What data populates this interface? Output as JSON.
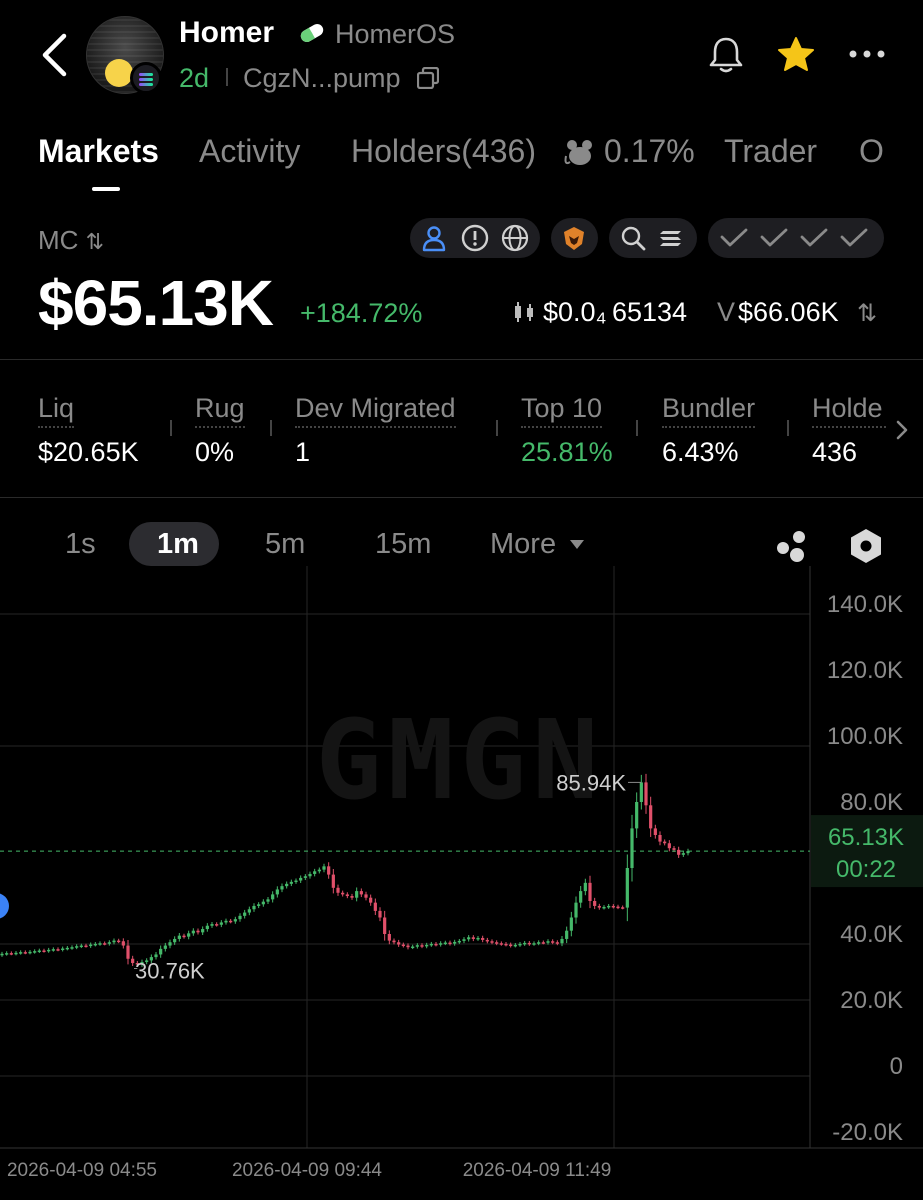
{
  "header": {
    "name": "Homer",
    "tag": "HomerOS",
    "age": "2d",
    "address": "CgzN...pump"
  },
  "tabs": [
    {
      "label": "Markets",
      "active": true
    },
    {
      "label": "Activity",
      "active": false
    },
    {
      "label": "Holders(436)",
      "active": false
    },
    {
      "label": "0.17%",
      "active": false
    },
    {
      "label": "Trader",
      "active": false
    },
    {
      "label": "O",
      "active": false
    }
  ],
  "market": {
    "mc_label": "MC",
    "mc_value": "$65.13K",
    "mc_change": "+184.72%",
    "price": "$0.0₄ 65134",
    "volume_label": "V",
    "volume": "$66.06K"
  },
  "stats": [
    {
      "label": "Liq",
      "value": "$20.65K",
      "color": "#ffffff"
    },
    {
      "label": "Rug",
      "value": "0%",
      "color": "#ffffff"
    },
    {
      "label": "Dev Migrated",
      "value": "1",
      "color": "#ffffff"
    },
    {
      "label": "Top 10",
      "value": "25.81%",
      "color": "#45b96a"
    },
    {
      "label": "Bundler",
      "value": "6.43%",
      "color": "#ffffff"
    },
    {
      "label": "Holde",
      "value": "436",
      "color": "#ffffff"
    }
  ],
  "timeframes": [
    {
      "label": "1s",
      "active": false
    },
    {
      "label": "1m",
      "active": true
    },
    {
      "label": "5m",
      "active": false
    },
    {
      "label": "15m",
      "active": false
    },
    {
      "label": "More",
      "active": false
    }
  ],
  "colors": {
    "up": "#45b96a",
    "down": "#e0506a",
    "muted": "#8a8a8a"
  },
  "chart_data": {
    "type": "candlestick",
    "watermark": "GMGN",
    "y_ticks": [
      "140.0K",
      "120.0K",
      "100.0K",
      "80.0K",
      "60.0K",
      "40.0K",
      "20.0K",
      "0",
      "-20.0K"
    ],
    "y_tick_values": [
      140000,
      120000,
      100000,
      80000,
      60000,
      40000,
      20000,
      0,
      -20000
    ],
    "ylim": [
      -20000,
      140000
    ],
    "x_ticks": [
      "2026-04-09 04:55",
      "2026-04-09 09:44",
      "2026-04-09 11:49"
    ],
    "current_price_label": "65.13K",
    "current_price": 65130,
    "countdown": "00:22",
    "high_label": "85.94K",
    "high": 85940,
    "low_label": "30.76K",
    "low": 30760,
    "close_series": [
      34000,
      34200,
      34100,
      34300,
      34500,
      34400,
      34600,
      34800,
      35000,
      34900,
      35200,
      35400,
      35300,
      35600,
      35800,
      36000,
      36300,
      36500,
      36400,
      36800,
      37000,
      37200,
      37100,
      37500,
      38000,
      37800,
      36500,
      32500,
      31200,
      30760,
      31500,
      32000,
      33000,
      33800,
      35500,
      36500,
      37500,
      38500,
      39500,
      39200,
      40200,
      41000,
      40500,
      41500,
      42500,
      43000,
      42800,
      43500,
      44000,
      43800,
      44500,
      45500,
      46500,
      47500,
      48500,
      49000,
      49800,
      50500,
      52000,
      53500,
      54500,
      55200,
      55800,
      56200,
      57000,
      57500,
      58200,
      59000,
      59500,
      60500,
      58000,
      54000,
      52500,
      52000,
      51500,
      51000,
      53000,
      52000,
      51000,
      49500,
      47000,
      45000,
      40000,
      38000,
      37500,
      36800,
      36500,
      36000,
      36200,
      36600,
      36300,
      36700,
      37000,
      36800,
      37200,
      37400,
      37100,
      37600,
      37900,
      38400,
      39000,
      38500,
      38800,
      38200,
      37800,
      37500,
      37200,
      37000,
      36800,
      36500,
      36700,
      37000,
      37300,
      37000,
      37200,
      37500,
      37400,
      37800,
      37500,
      37200,
      38500,
      41000,
      45000,
      49500,
      53000,
      55500,
      50000,
      48500,
      48000,
      48200,
      48500,
      48300,
      48100,
      48000,
      60000,
      72000,
      80000,
      85940,
      79000,
      72000,
      70000,
      68000,
      67500,
      66000,
      65500,
      64000,
      64500,
      65130
    ]
  }
}
